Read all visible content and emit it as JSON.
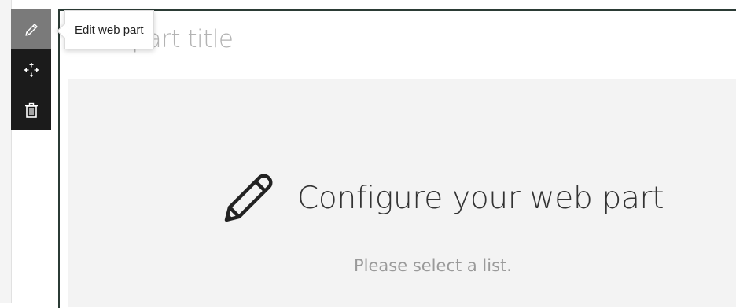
{
  "toolbar": {
    "items": [
      {
        "icon": "pencil-icon",
        "label": "Edit web part",
        "active": true
      },
      {
        "icon": "move-icon",
        "label": "Move web part"
      },
      {
        "icon": "trash-icon",
        "label": "Delete web part"
      }
    ]
  },
  "tooltip": {
    "text": "Edit web part"
  },
  "webpart": {
    "title_placeholder": "Web part title",
    "configure_heading": "Configure your web part",
    "configure_description": "Please select a list."
  },
  "colors": {
    "toolbar_bg": "#1b1b1b",
    "active_button": "#7a7a7a",
    "placeholder_bg": "#f3f3f3",
    "frame_border": "#2b3b35"
  }
}
